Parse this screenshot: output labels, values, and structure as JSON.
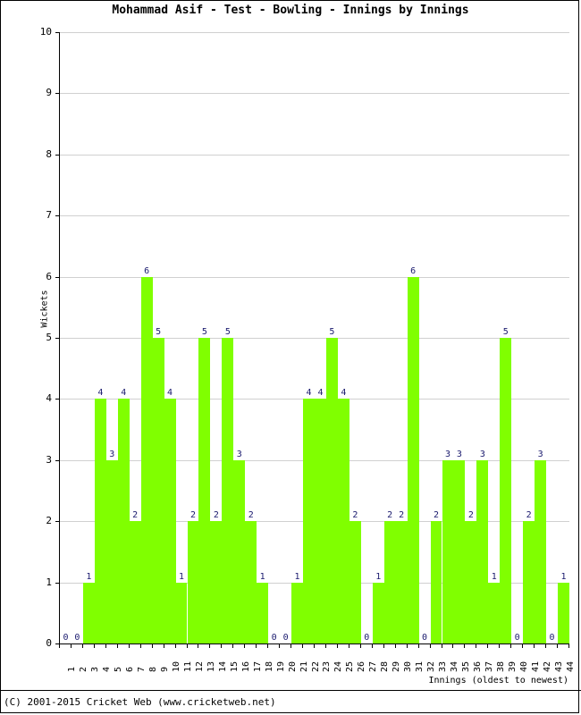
{
  "title": "Mohammad Asif - Test - Bowling - Innings by Innings",
  "footer": "(C) 2001-2015 Cricket Web (www.cricketweb.net)",
  "axis": {
    "y_title": "Wickets",
    "x_title": "Innings (oldest to newest)"
  },
  "colors": {
    "bar": "#80FF00",
    "grid": "#d0d0d0",
    "label": "#1a1a6e",
    "axis": "#000000",
    "background": "#ffffff"
  },
  "chart_data": {
    "type": "bar",
    "title": "Mohammad Asif - Test - Bowling - Innings by Innings",
    "xlabel": "Innings (oldest to newest)",
    "ylabel": "Wickets",
    "ylim": [
      0,
      10
    ],
    "yticks": [
      0,
      1,
      2,
      3,
      4,
      5,
      6,
      7,
      8,
      9,
      10
    ],
    "grid": true,
    "legend": "none",
    "categories": [
      "1",
      "2",
      "3",
      "4",
      "5",
      "6",
      "7",
      "8",
      "9",
      "10",
      "11",
      "12",
      "13",
      "14",
      "15",
      "16",
      "17",
      "18",
      "19",
      "20",
      "21",
      "22",
      "23",
      "24",
      "25",
      "26",
      "27",
      "28",
      "29",
      "30",
      "31",
      "32",
      "33",
      "34",
      "35",
      "36",
      "37",
      "38",
      "39",
      "40",
      "41",
      "42",
      "43",
      "44"
    ],
    "values": [
      0,
      0,
      1,
      4,
      3,
      4,
      2,
      6,
      5,
      4,
      1,
      2,
      5,
      2,
      5,
      3,
      2,
      1,
      0,
      0,
      1,
      4,
      4,
      5,
      4,
      2,
      0,
      1,
      2,
      2,
      6,
      0,
      2,
      3,
      3,
      2,
      3,
      1,
      5,
      0,
      2,
      3,
      0,
      1
    ],
    "data_labels": [
      "0",
      "0",
      "1",
      "4",
      "3",
      "4",
      "2",
      "6",
      "5",
      "4",
      "1",
      "2",
      "5",
      "2",
      "5",
      "3",
      "2",
      "1",
      "0",
      "0",
      "1",
      "4",
      "4",
      "5",
      "4",
      "2",
      "0",
      "1",
      "2",
      "2",
      "6",
      "0",
      "2",
      "3",
      "3",
      "2",
      "3",
      "1",
      "5",
      "0",
      "2",
      "3",
      "0",
      "1"
    ]
  }
}
